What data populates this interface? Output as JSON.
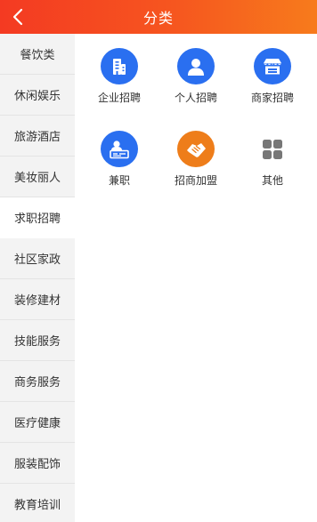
{
  "header": {
    "title": "分类",
    "back_icon": "chevron-left-icon",
    "gradient": [
      "#f43a22",
      "#f77b1c"
    ]
  },
  "sidebar": {
    "active_index": 4,
    "items": [
      {
        "label": "餐饮类"
      },
      {
        "label": "休闲娱乐"
      },
      {
        "label": "旅游酒店"
      },
      {
        "label": "美妆丽人"
      },
      {
        "label": "求职招聘"
      },
      {
        "label": "社区家政"
      },
      {
        "label": "装修建材"
      },
      {
        "label": "技能服务"
      },
      {
        "label": "商务服务"
      },
      {
        "label": "医疗健康"
      },
      {
        "label": "服装配饰"
      },
      {
        "label": "教育培训"
      }
    ]
  },
  "subcategories": [
    {
      "label": "企业招聘",
      "icon": "building-icon",
      "color": "#2a6ff0"
    },
    {
      "label": "个人招聘",
      "icon": "person-icon",
      "color": "#2a6ff0"
    },
    {
      "label": "商家招聘",
      "icon": "storefront-icon",
      "color": "#2a6ff0"
    },
    {
      "label": "兼职",
      "icon": "id-card-icon",
      "color": "#2a6ff0"
    },
    {
      "label": "招商加盟",
      "icon": "handshake-icon",
      "color": "#ee7d1a"
    },
    {
      "label": "其他",
      "icon": "grid-icon",
      "color": "#777777"
    }
  ]
}
